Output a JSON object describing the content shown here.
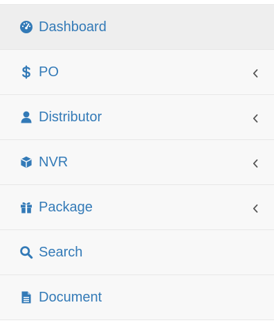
{
  "colors": {
    "accent": "#337ab7",
    "sidebar_bg": "#f8f8f8",
    "active_bg": "#eeeeee",
    "divider": "#e7e7e7",
    "chevron": "#555555"
  },
  "sidebar": {
    "items": [
      {
        "label": "Dashboard",
        "icon": "dashboard-icon",
        "active": true,
        "has_submenu": false
      },
      {
        "label": "PO",
        "icon": "dollar-icon",
        "active": false,
        "has_submenu": true
      },
      {
        "label": "Distributor",
        "icon": "user-icon",
        "active": false,
        "has_submenu": true
      },
      {
        "label": "NVR",
        "icon": "cube-icon",
        "active": false,
        "has_submenu": true
      },
      {
        "label": "Package",
        "icon": "gift-icon",
        "active": false,
        "has_submenu": true
      },
      {
        "label": "Search",
        "icon": "search-icon",
        "active": false,
        "has_submenu": false
      },
      {
        "label": "Document",
        "icon": "document-icon",
        "active": false,
        "has_submenu": false
      }
    ]
  }
}
